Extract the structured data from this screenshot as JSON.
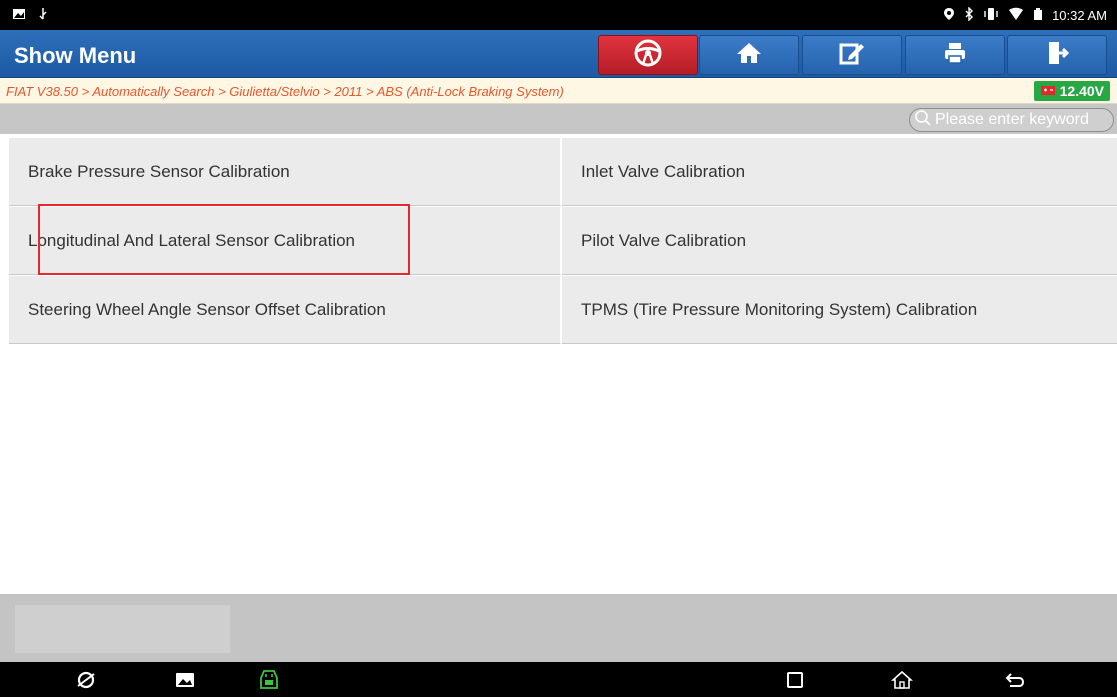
{
  "status_bar": {
    "time": "10:32 AM",
    "left_icons": [
      "image-icon",
      "usb-icon"
    ],
    "right_icons": [
      "location-icon",
      "bluetooth-icon",
      "vibrate-icon",
      "wifi-icon",
      "battery-icon"
    ]
  },
  "header": {
    "title": "Show Menu",
    "buttons": [
      {
        "name": "steering-wheel-icon",
        "color": "#c62830"
      },
      {
        "name": "home-icon",
        "color": "#2a69b5"
      },
      {
        "name": "edit-icon",
        "color": "#2a69b5"
      },
      {
        "name": "print-icon",
        "color": "#2a69b5"
      },
      {
        "name": "exit-icon",
        "color": "#2a69b5"
      }
    ]
  },
  "breadcrumb": {
    "path": "FIAT V38.50 > Automatically Search > Giulietta/Stelvio > 2011 > ABS (Anti-Lock Braking System)",
    "voltage": "12.40V"
  },
  "search": {
    "placeholder": "Please enter keyword"
  },
  "menu": {
    "items": [
      {
        "label": "Brake Pressure Sensor Calibration"
      },
      {
        "label": "Inlet Valve Calibration"
      },
      {
        "label": "Longitudinal And Lateral Sensor Calibration",
        "highlighted": true
      },
      {
        "label": "Pilot Valve Calibration"
      },
      {
        "label": "Steering Wheel Angle Sensor Offset Calibration"
      },
      {
        "label": "TPMS (Tire Pressure Monitoring System) Calibration"
      }
    ]
  },
  "colors": {
    "header_blue": "#2a69b5",
    "breadcrumb_text": "#e8572b",
    "voltage_green": "#28a745",
    "highlight_red": "#e5282e"
  },
  "navbar": {
    "icons": [
      "browser-icon",
      "gallery-icon",
      "vci-icon",
      "recents-icon",
      "home-nav-icon",
      "back-icon"
    ]
  }
}
